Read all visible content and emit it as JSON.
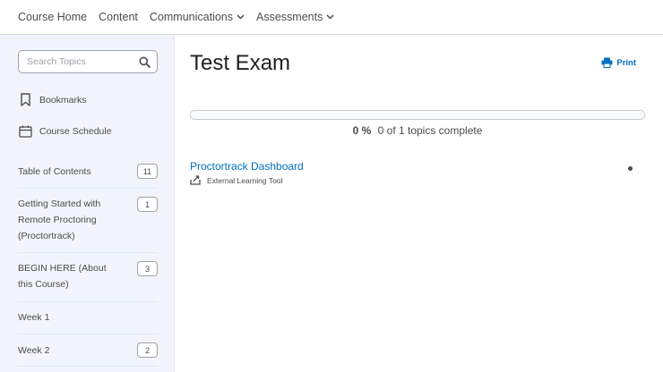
{
  "nav": {
    "items": [
      {
        "label": "Course Home",
        "dropdown": false
      },
      {
        "label": "Content",
        "dropdown": false
      },
      {
        "label": "Communications",
        "dropdown": true
      },
      {
        "label": "Assessments",
        "dropdown": true
      }
    ]
  },
  "sidebar": {
    "search_placeholder": "Search Topics",
    "bookmarks_label": "Bookmarks",
    "schedule_label": "Course Schedule",
    "toc": [
      {
        "label": "Table of Contents",
        "count": "11"
      },
      {
        "label": "Getting Started with Remote Proctoring (Proctortrack)",
        "count": "1"
      },
      {
        "label": "BEGIN HERE (About this Course)",
        "count": "3"
      },
      {
        "label": "Week 1",
        "count": ""
      },
      {
        "label": "Week 2",
        "count": "2"
      }
    ]
  },
  "main": {
    "title": "Test Exam",
    "print_label": "Print",
    "progress": {
      "percent_label": "0 %",
      "summary": "0 of 1 topics complete",
      "fraction": 0
    },
    "topic": {
      "title": "Proctortrack Dashboard",
      "type": "External Learning Tool"
    }
  },
  "colors": {
    "link": "#006fbf",
    "text": "#494c4e",
    "sidebar_bg": "#f1f5fb"
  },
  "icons": [
    "search-icon",
    "bookmark-icon",
    "calendar-icon",
    "printer-icon",
    "chevron-down-icon",
    "external-tool-icon"
  ]
}
